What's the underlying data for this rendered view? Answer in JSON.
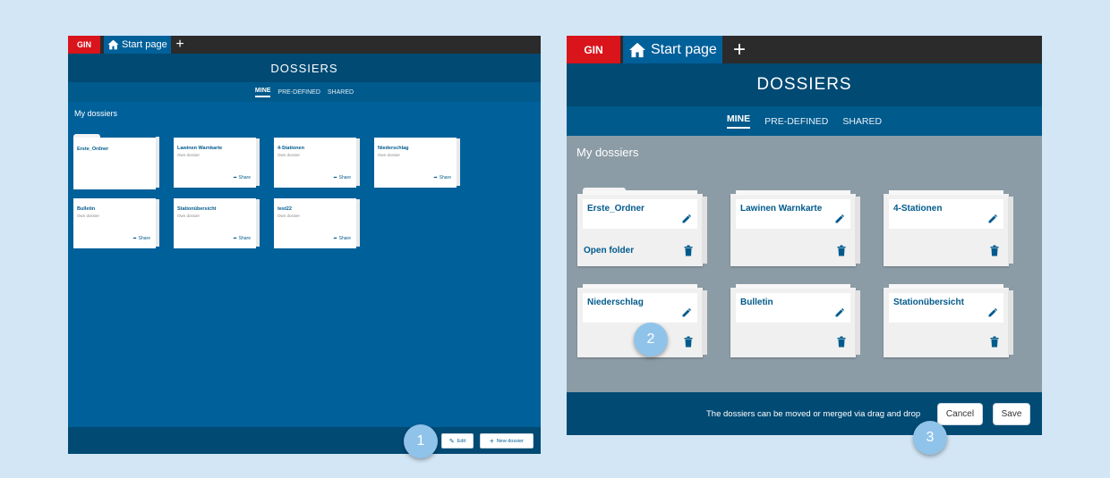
{
  "app": {
    "logo": "GIN",
    "tab_label": "Start page",
    "new_tab_symbol": "+"
  },
  "header": {
    "title": "DOSSIERS"
  },
  "tabs": [
    {
      "label": "MINE",
      "active": true
    },
    {
      "label": "PRE-DEFINED"
    },
    {
      "label": "SHARED"
    }
  ],
  "section_title": "My dossiers",
  "view_mode": {
    "dossiers": [
      {
        "name": "Erste_Ordner",
        "subtitle": "",
        "share": ""
      },
      {
        "name": "Lawinen Warnkarte",
        "subtitle": "Own dossier",
        "share": "Share"
      },
      {
        "name": "4-Stationen",
        "subtitle": "Own dossier",
        "share": "Share"
      },
      {
        "name": "Niederschlag",
        "subtitle": "Own dossier",
        "share": "Share"
      },
      {
        "name": "Bulletin",
        "subtitle": "Own dossier",
        "share": "Share"
      },
      {
        "name": "Stationübersicht",
        "subtitle": "Own dossier",
        "share": "Share"
      },
      {
        "name": "test22",
        "subtitle": "Own dossier",
        "share": "Share"
      }
    ],
    "edit_label": "Edit",
    "new_dossier_label": "New dossier"
  },
  "edit_mode": {
    "dossiers": [
      {
        "name": "Erste_Ordner",
        "action": "Open folder"
      },
      {
        "name": "Lawinen Warnkarte",
        "action": ""
      },
      {
        "name": "4-Stationen",
        "action": ""
      },
      {
        "name": "Niederschlag",
        "action": ""
      },
      {
        "name": "Bulletin",
        "action": ""
      },
      {
        "name": "Stationübersicht",
        "action": ""
      }
    ],
    "hint": "The dossiers can be moved or merged via drag and drop",
    "cancel_label": "Cancel",
    "save_label": "Save"
  },
  "callouts": [
    "1",
    "2",
    "3"
  ],
  "colors": {
    "accent": "#00609a",
    "header": "#004a73",
    "brand": "#d9141b",
    "edit_bg": "#8c9ca6",
    "callout": "#8fc3ea"
  }
}
